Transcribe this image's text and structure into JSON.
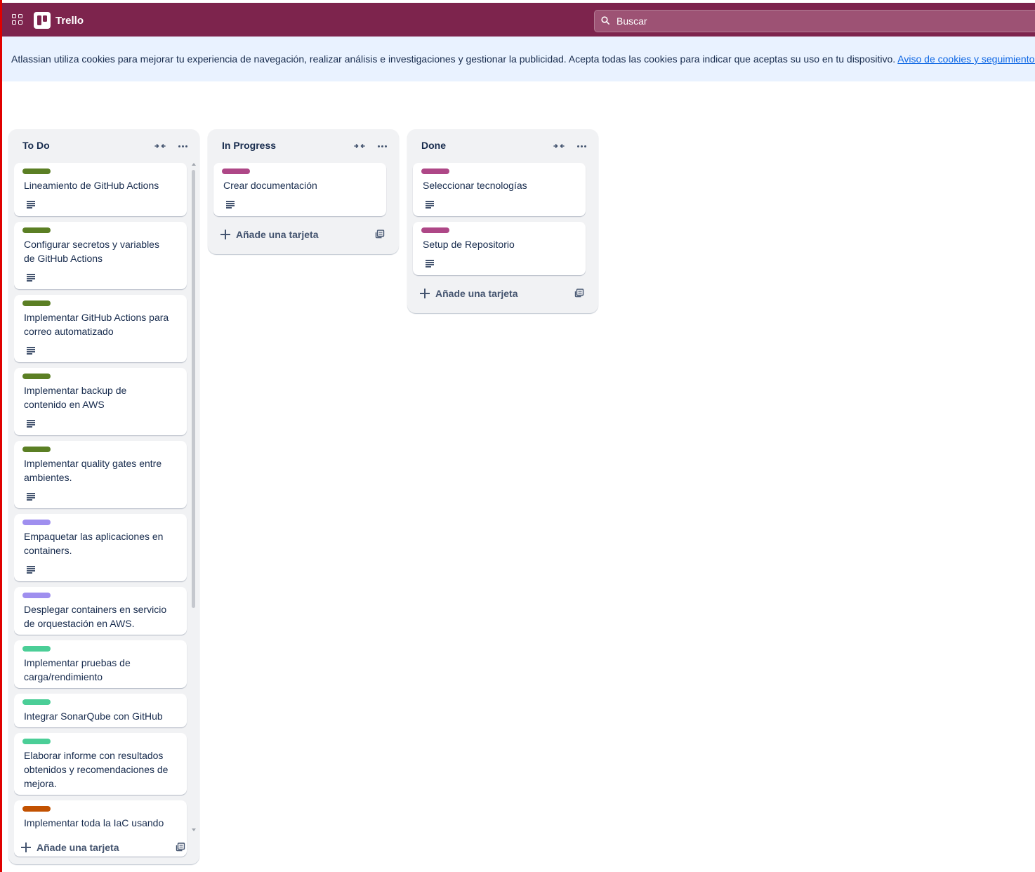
{
  "header": {
    "app_name": "Trello",
    "search_placeholder": "Buscar"
  },
  "cookie_banner": {
    "text": "Atlassian utiliza cookies para mejorar tu experiencia de navegación, realizar análisis e investigaciones y gestionar la publicidad. Acepta todas las cookies para indicar que aceptas su uso en tu dispositivo.",
    "link": "Aviso de cookies y seguimiento de"
  },
  "colors": {
    "header_bg": "#7d244d",
    "label_green": "#5b7f24",
    "label_pink": "#ae4787",
    "label_purple": "#9f8fef",
    "label_teal": "#4bce97",
    "label_orange": "#c25100"
  },
  "icons": {
    "apps": "apps-grid-icon",
    "search": "search-icon",
    "collapse": "collapse-list-icon",
    "more": "more-horizontal-icon",
    "description": "description-icon",
    "add": "plus-icon",
    "template": "card-template-icon"
  },
  "lists": [
    {
      "title": "To Do",
      "add_label": "Añade una tarjeta",
      "cards": [
        {
          "title": "Lineamiento de GitHub Actions",
          "label_color": "#5b7f24",
          "has_description": true
        },
        {
          "title": "Configurar secretos y variables de GitHub Actions",
          "label_color": "#5b7f24",
          "has_description": true
        },
        {
          "title": "Implementar GitHub Actions para correo automatizado",
          "label_color": "#5b7f24",
          "has_description": true
        },
        {
          "title": "Implementar backup de contenido en AWS",
          "label_color": "#5b7f24",
          "has_description": true
        },
        {
          "title": "Implementar quality gates entre ambientes.",
          "label_color": "#5b7f24",
          "has_description": true
        },
        {
          "title": "Empaquetar las aplicaciones en containers.",
          "label_color": "#9f8fef",
          "has_description": true
        },
        {
          "title": "Desplegar containers en servicio de orquestación en AWS.",
          "label_color": "#9f8fef",
          "has_description": false
        },
        {
          "title": "Implementar pruebas de carga/rendimiento",
          "label_color": "#4bce97",
          "has_description": false
        },
        {
          "title": "Integrar SonarQube con GitHub",
          "label_color": "#4bce97",
          "has_description": false
        },
        {
          "title": "Elaborar informe con resultados obtenidos y recomendaciones de mejora.",
          "label_color": "#4bce97",
          "has_description": false
        },
        {
          "title": "Implementar toda la IaC usando",
          "label_color": "#c25100",
          "has_description": false
        }
      ]
    },
    {
      "title": "In Progress",
      "add_label": "Añade una tarjeta",
      "cards": [
        {
          "title": "Crear documentación",
          "label_color": "#ae4787",
          "has_description": true
        }
      ]
    },
    {
      "title": "Done",
      "add_label": "Añade una tarjeta",
      "cards": [
        {
          "title": "Seleccionar tecnologías",
          "label_color": "#ae4787",
          "has_description": true
        },
        {
          "title": "Setup de Repositorio",
          "label_color": "#ae4787",
          "has_description": true
        }
      ]
    }
  ]
}
